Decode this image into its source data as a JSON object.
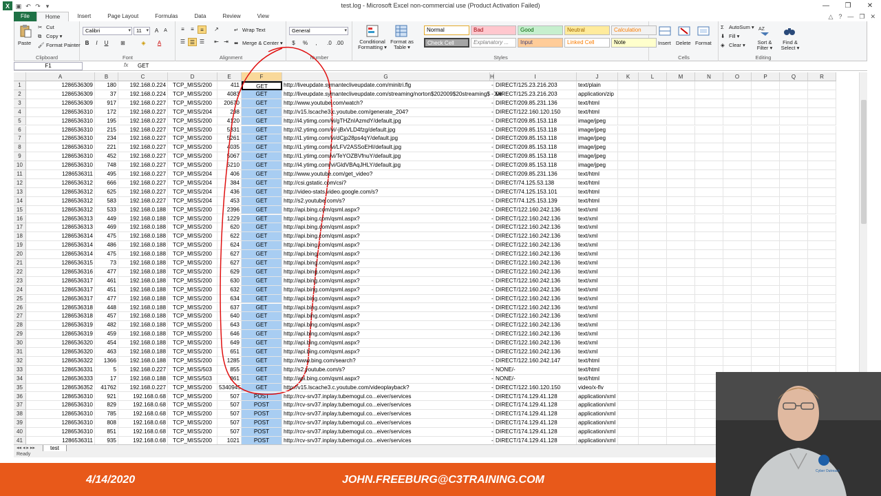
{
  "window": {
    "title": "test.log  -  Microsoft Excel non-commercial use (Product Activation Failed)"
  },
  "ribbon_tabs": [
    "File",
    "Home",
    "Insert",
    "Page Layout",
    "Formulas",
    "Data",
    "Review",
    "View"
  ],
  "ribbon": {
    "clipboard": {
      "label": "Clipboard",
      "paste": "Paste",
      "cut": "Cut",
      "copy": "Copy ▾",
      "format_painter": "Format Painter"
    },
    "font": {
      "label": "Font",
      "name": "Calibri",
      "size": "11"
    },
    "alignment": {
      "label": "Alignment",
      "wrap": "Wrap Text",
      "merge": "Merge & Center ▾"
    },
    "number": {
      "label": "Number",
      "format": "General"
    },
    "styles": {
      "label": "Styles",
      "conditional": "Conditional Formatting ▾",
      "format_table": "Format as Table ▾",
      "items": [
        {
          "name": "Normal",
          "bg": "#ffffff",
          "fg": "#000000"
        },
        {
          "name": "Bad",
          "bg": "#ffc7ce",
          "fg": "#9c0006"
        },
        {
          "name": "Good",
          "bg": "#c6efce",
          "fg": "#006100"
        },
        {
          "name": "Neutral",
          "bg": "#ffeb9c",
          "fg": "#9c6500"
        },
        {
          "name": "Calculation",
          "bg": "#f2f2f2",
          "fg": "#fa7d00"
        },
        {
          "name": "Check Cell",
          "bg": "#a5a5a5",
          "fg": "#ffffff"
        },
        {
          "name": "Explanatory ...",
          "bg": "#ffffff",
          "fg": "#7f7f7f"
        },
        {
          "name": "Input",
          "bg": "#ffcc99",
          "fg": "#3f3f76"
        },
        {
          "name": "Linked Cell",
          "bg": "#ffffff",
          "fg": "#fa7d00"
        },
        {
          "name": "Note",
          "bg": "#ffffcc",
          "fg": "#000000"
        }
      ]
    },
    "cells": {
      "label": "Cells",
      "insert": "Insert",
      "delete": "Delete",
      "format": "Format"
    },
    "editing": {
      "label": "Editing",
      "autosum": "AutoSum ▾",
      "fill": "Fill ▾",
      "clear": "Clear ▾",
      "sort": "Sort & Filter ▾",
      "find": "Find & Select ▾"
    }
  },
  "formula_bar": {
    "name_box": "F1",
    "fx": "fx",
    "content": "GET"
  },
  "columns": [
    "A",
    "B",
    "C",
    "D",
    "E",
    "F",
    "G",
    "H",
    "I",
    "J",
    "K",
    "L",
    "M",
    "N",
    "O",
    "P",
    "Q",
    "R"
  ],
  "rows": [
    [
      "1286536309",
      "180",
      "192.168.0.224",
      "TCP_MISS/200",
      "411",
      "GET",
      "http://liveupdate.symantecliveupdate.com/minitri.flg",
      "-",
      "DIRECT/125.23.216.203",
      "text/plain"
    ],
    [
      "1286536309",
      "37",
      "192.168.0.224",
      "TCP_MISS/200",
      "4083",
      "GET",
      "http://liveupdate.symantecliveupdate.com/streaming/norton$202009$20streaming$20vir",
      "-",
      "DIRECT/125.23.216.203",
      "application/zip"
    ],
    [
      "1286536309",
      "917",
      "192.168.0.227",
      "TCP_MISS/200",
      "20670",
      "GET",
      "http://www.youtube.com/watch?",
      "-",
      "DIRECT/209.85.231.136",
      "text/html"
    ],
    [
      "1286536310",
      "172",
      "192.168.0.227",
      "TCP_MISS/204",
      "298",
      "GET",
      "http://v15.lscache3.c.youtube.com/generate_204?",
      "-",
      "DIRECT/122.160.120.150",
      "text/html"
    ],
    [
      "1286536310",
      "195",
      "192.168.0.227",
      "TCP_MISS/200",
      "4120",
      "GET",
      "http://i4.ytimg.com/vi/gTHZnIAzmdY/default.jpg",
      "-",
      "DIRECT/209.85.153.118",
      "image/jpeg"
    ],
    [
      "1286536310",
      "215",
      "192.168.0.227",
      "TCP_MISS/200",
      "5331",
      "GET",
      "http://i2.ytimg.com/vi/-jBxVLD4fzg/default.jpg",
      "-",
      "DIRECT/209.85.153.118",
      "image/jpeg"
    ],
    [
      "1286536310",
      "234",
      "192.168.0.227",
      "TCP_MISS/200",
      "5261",
      "GET",
      "http://i1.ytimg.com/vi/dCjp28ps4qY/default.jpg",
      "-",
      "DIRECT/209.85.153.118",
      "image/jpeg"
    ],
    [
      "1286536310",
      "221",
      "192.168.0.227",
      "TCP_MISS/200",
      "4035",
      "GET",
      "http://i1.ytimg.com/vi/LFV2ASSoEHI/default.jpg",
      "-",
      "DIRECT/209.85.153.118",
      "image/jpeg"
    ],
    [
      "1286536310",
      "452",
      "192.168.0.227",
      "TCP_MISS/200",
      "5067",
      "GET",
      "http://i1.ytimg.com/vi/TeYOZBVfnuY/default.jpg",
      "-",
      "DIRECT/209.85.153.118",
      "image/jpeg"
    ],
    [
      "1286536310",
      "748",
      "192.168.0.227",
      "TCP_MISS/200",
      "5210",
      "GET",
      "http://i4.ytimg.com/vi/GldVBAqJHLY/default.jpg",
      "-",
      "DIRECT/209.85.153.118",
      "image/jpeg"
    ],
    [
      "1286536311",
      "495",
      "192.168.0.227",
      "TCP_MISS/204",
      "406",
      "GET",
      "http://www.youtube.com/get_video?",
      "-",
      "DIRECT/209.85.231.136",
      "text/html"
    ],
    [
      "1286536312",
      "666",
      "192.168.0.227",
      "TCP_MISS/204",
      "384",
      "GET",
      "http://csi.gstatic.com/csi?",
      "-",
      "DIRECT/74.125.53.138",
      "text/html"
    ],
    [
      "1286536312",
      "625",
      "192.168.0.227",
      "TCP_MISS/204",
      "436",
      "GET",
      "http://video-stats.video.google.com/s?",
      "-",
      "DIRECT/74.125.153.101",
      "text/html"
    ],
    [
      "1286536312",
      "583",
      "192.168.0.227",
      "TCP_MISS/204",
      "453",
      "GET",
      "http://s2.youtube.com/s?",
      "-",
      "DIRECT/74.125.153.139",
      "text/html"
    ],
    [
      "1286536312",
      "533",
      "192.168.0.188",
      "TCP_MISS/200",
      "2396",
      "GET",
      "http://api.bing.com/qsml.aspx?",
      "-",
      "DIRECT/122.160.242.136",
      "text/xml"
    ],
    [
      "1286536313",
      "449",
      "192.168.0.188",
      "TCP_MISS/200",
      "1229",
      "GET",
      "http://api.bing.com/qsml.aspx?",
      "-",
      "DIRECT/122.160.242.136",
      "text/xml"
    ],
    [
      "1286536313",
      "469",
      "192.168.0.188",
      "TCP_MISS/200",
      "620",
      "GET",
      "http://api.bing.com/qsml.aspx?",
      "-",
      "DIRECT/122.160.242.136",
      "text/xml"
    ],
    [
      "1286536314",
      "475",
      "192.168.0.188",
      "TCP_MISS/200",
      "622",
      "GET",
      "http://api.bing.com/qsml.aspx?",
      "-",
      "DIRECT/122.160.242.136",
      "text/xml"
    ],
    [
      "1286536314",
      "486",
      "192.168.0.188",
      "TCP_MISS/200",
      "624",
      "GET",
      "http://api.bing.com/qsml.aspx?",
      "-",
      "DIRECT/122.160.242.136",
      "text/xml"
    ],
    [
      "1286536314",
      "475",
      "192.168.0.188",
      "TCP_MISS/200",
      "627",
      "GET",
      "http://api.bing.com/qsml.aspx?",
      "-",
      "DIRECT/122.160.242.136",
      "text/xml"
    ],
    [
      "1286536315",
      "73",
      "192.168.0.188",
      "TCP_MISS/200",
      "627",
      "GET",
      "http://api.bing.com/qsml.aspx?",
      "-",
      "DIRECT/122.160.242.136",
      "text/xml"
    ],
    [
      "1286536316",
      "477",
      "192.168.0.188",
      "TCP_MISS/200",
      "629",
      "GET",
      "http://api.bing.com/qsml.aspx?",
      "-",
      "DIRECT/122.160.242.136",
      "text/xml"
    ],
    [
      "1286536317",
      "461",
      "192.168.0.188",
      "TCP_MISS/200",
      "630",
      "GET",
      "http://api.bing.com/qsml.aspx?",
      "-",
      "DIRECT/122.160.242.136",
      "text/xml"
    ],
    [
      "1286536317",
      "451",
      "192.168.0.188",
      "TCP_MISS/200",
      "632",
      "GET",
      "http://api.bing.com/qsml.aspx?",
      "-",
      "DIRECT/122.160.242.136",
      "text/xml"
    ],
    [
      "1286536317",
      "477",
      "192.168.0.188",
      "TCP_MISS/200",
      "634",
      "GET",
      "http://api.bing.com/qsml.aspx?",
      "-",
      "DIRECT/122.160.242.136",
      "text/xml"
    ],
    [
      "1286536318",
      "448",
      "192.168.0.188",
      "TCP_MISS/200",
      "637",
      "GET",
      "http://api.bing.com/qsml.aspx?",
      "-",
      "DIRECT/122.160.242.136",
      "text/xml"
    ],
    [
      "1286536318",
      "457",
      "192.168.0.188",
      "TCP_MISS/200",
      "640",
      "GET",
      "http://api.bing.com/qsml.aspx?",
      "-",
      "DIRECT/122.160.242.136",
      "text/xml"
    ],
    [
      "1286536319",
      "482",
      "192.168.0.188",
      "TCP_MISS/200",
      "643",
      "GET",
      "http://api.bing.com/qsml.aspx?",
      "-",
      "DIRECT/122.160.242.136",
      "text/xml"
    ],
    [
      "1286536319",
      "459",
      "192.168.0.188",
      "TCP_MISS/200",
      "646",
      "GET",
      "http://api.bing.com/qsml.aspx?",
      "-",
      "DIRECT/122.160.242.136",
      "text/xml"
    ],
    [
      "1286536320",
      "454",
      "192.168.0.188",
      "TCP_MISS/200",
      "649",
      "GET",
      "http://api.bing.com/qsml.aspx?",
      "-",
      "DIRECT/122.160.242.136",
      "text/xml"
    ],
    [
      "1286536320",
      "463",
      "192.168.0.188",
      "TCP_MISS/200",
      "651",
      "GET",
      "http://api.bing.com/qsml.aspx?",
      "-",
      "DIRECT/122.160.242.136",
      "text/xml"
    ],
    [
      "1286536322",
      "1366",
      "192.168.0.188",
      "TCP_MISS/200",
      "1285",
      "GET",
      "http://www.bing.com/search?",
      "-",
      "DIRECT/122.160.242.147",
      "text/html"
    ],
    [
      "1286536331",
      "5",
      "192.168.0.227",
      "TCP_MISS/503",
      "855",
      "GET",
      "http://s2.youtube.com/s?",
      "-",
      "NONE/-",
      "text/html"
    ],
    [
      "1286536333",
      "17",
      "192.168.0.188",
      "TCP_MISS/503",
      "861",
      "GET",
      "http://api.bing.com/qsml.aspx?",
      "-",
      "NONE/-",
      "text/html"
    ],
    [
      "1286536352",
      "41762",
      "192.168.0.227",
      "TCP_MISS/200",
      "5340945",
      "GET",
      "http://v15.lscache3.c.youtube.com/videoplayback?",
      "-",
      "DIRECT/122.160.120.150",
      "video/x-flv"
    ],
    [
      "1286536310",
      "921",
      "192.168.0.68",
      "TCP_MISS/200",
      "507",
      "POST",
      "http://rcv-srv37.inplay.tubemogul.co...eiver/services",
      "-",
      "DIRECT/174.129.41.128",
      "application/xml"
    ],
    [
      "1286536310",
      "829",
      "192.168.0.68",
      "TCP_MISS/200",
      "507",
      "POST",
      "http://rcv-srv37.inplay.tubemogul.co...eiver/services",
      "-",
      "DIRECT/174.129.41.128",
      "application/xml"
    ],
    [
      "1286536310",
      "785",
      "192.168.0.68",
      "TCP_MISS/200",
      "507",
      "POST",
      "http://rcv-srv37.inplay.tubemogul.co...eiver/services",
      "-",
      "DIRECT/174.129.41.128",
      "application/xml"
    ],
    [
      "1286536310",
      "808",
      "192.168.0.68",
      "TCP_MISS/200",
      "507",
      "POST",
      "http://rcv-srv37.inplay.tubemogul.co...eiver/services",
      "-",
      "DIRECT/174.129.41.128",
      "application/xml"
    ],
    [
      "1286536310",
      "851",
      "192.168.0.68",
      "TCP_MISS/200",
      "507",
      "POST",
      "http://rcv-srv37.inplay.tubemogul.co...eiver/services",
      "-",
      "DIRECT/174.129.41.128",
      "application/xml"
    ],
    [
      "1286536311",
      "935",
      "192.168.0.68",
      "TCP_MISS/200",
      "1021",
      "POST",
      "http://rcv-srv37.inplay.tubemogul.co...eiver/services",
      "-",
      "DIRECT/174.129.41.128",
      "application/xml"
    ]
  ],
  "sheet": {
    "tab": "test",
    "status": "Ready"
  },
  "footer": {
    "date": "4/14/2020",
    "email": "JOHN.FREEBURG@C3TRAINING.COM",
    "bg": "#e8591a"
  },
  "webcam": {
    "logo": "Cyber Outreach"
  }
}
